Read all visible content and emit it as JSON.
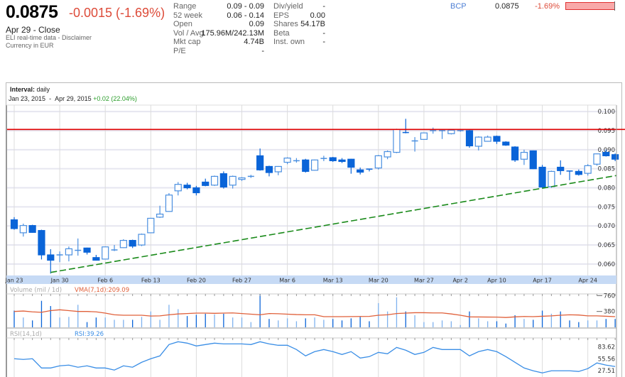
{
  "quote": {
    "price": "0.0875",
    "change": "-0.0015 (-1.69%)",
    "close_label": "Apr 29 - Close",
    "source_note": "ELI real-time data - Disclaimer",
    "currency_note": "Currency in EUR",
    "change_color": "#dd4b39"
  },
  "stats_left": [
    {
      "label": "Range",
      "value": "0.09 - 0.09"
    },
    {
      "label": "52 week",
      "value": "0.06 - 0.14"
    },
    {
      "label": "Open",
      "value": "0.09"
    },
    {
      "label": "Vol / Avg.",
      "value": "175.96M/242.13M"
    },
    {
      "label": "Mkt cap",
      "value": "4.74B"
    },
    {
      "label": "P/E",
      "value": "-"
    }
  ],
  "stats_right": [
    {
      "label": "Div/yield",
      "value": "-"
    },
    {
      "label": "EPS",
      "value": "0.00"
    },
    {
      "label": "Shares",
      "value": "54.17B"
    },
    {
      "label": "Beta",
      "value": "-"
    },
    {
      "label": "Inst. own",
      "value": "-"
    }
  ],
  "compare": {
    "symbol": "BCP",
    "price": "0.0875",
    "change": "-1.69%"
  },
  "chart_header": {
    "interval_label": "Interval:",
    "interval_value": "daily",
    "start_date": "Jan 23, 2015",
    "separator": "-",
    "end_date": "Apr 29, 2015",
    "period_change": "+0.02 (22.04%)"
  },
  "chart_data": [
    {
      "type": "candlestick",
      "ylim": [
        0.057,
        0.1017
      ],
      "y_ticks": [
        "0.100",
        "0.095",
        "0.090",
        "0.085",
        "0.080",
        "0.075",
        "0.070",
        "0.065",
        "0.060"
      ],
      "x_tick_labels": [
        {
          "label": "Jan 23",
          "index": 0
        },
        {
          "label": "Jan 30",
          "index": 5
        },
        {
          "label": "Feb 6",
          "index": 10
        },
        {
          "label": "Feb 13",
          "index": 15
        },
        {
          "label": "Feb 20",
          "index": 20
        },
        {
          "label": "Feb 27",
          "index": 25
        },
        {
          "label": "Mar 6",
          "index": 30
        },
        {
          "label": "Mar 13",
          "index": 35
        },
        {
          "label": "Mar 20",
          "index": 40
        },
        {
          "label": "Mar 27",
          "index": 45
        },
        {
          "label": "Apr 2",
          "index": 49
        },
        {
          "label": "Apr 10",
          "index": 53
        },
        {
          "label": "Apr 17",
          "index": 58
        },
        {
          "label": "Apr 24",
          "index": 63
        }
      ],
      "ohlc": [
        [
          0.0716,
          0.0723,
          0.069,
          0.0693
        ],
        [
          0.0682,
          0.0706,
          0.0672,
          0.0701
        ],
        [
          0.0701,
          0.0703,
          0.0682,
          0.0683
        ],
        [
          0.0688,
          0.069,
          0.0612,
          0.0624
        ],
        [
          0.0624,
          0.0639,
          0.0575,
          0.061
        ],
        [
          0.0623,
          0.0633,
          0.0605,
          0.0624
        ],
        [
          0.0624,
          0.0646,
          0.0607,
          0.064
        ],
        [
          0.0634,
          0.0667,
          0.0622,
          0.0636
        ],
        [
          0.0642,
          0.0643,
          0.0625,
          0.0631
        ],
        [
          0.0617,
          0.0624,
          0.0609,
          0.061
        ],
        [
          0.0613,
          0.0646,
          0.0612,
          0.0645
        ],
        [
          0.0636,
          0.065,
          0.0634,
          0.0637
        ],
        [
          0.0643,
          0.0665,
          0.0642,
          0.0662
        ],
        [
          0.0662,
          0.0664,
          0.0642,
          0.0647
        ],
        [
          0.065,
          0.068,
          0.0647,
          0.0678
        ],
        [
          0.0682,
          0.0721,
          0.0681,
          0.072
        ],
        [
          0.0723,
          0.0753,
          0.0721,
          0.0731
        ],
        [
          0.0738,
          0.0786,
          0.0737,
          0.0781
        ],
        [
          0.0792,
          0.0815,
          0.078,
          0.0809
        ],
        [
          0.0807,
          0.0813,
          0.0796,
          0.08
        ],
        [
          0.08,
          0.0805,
          0.078,
          0.0787
        ],
        [
          0.0815,
          0.0824,
          0.0804,
          0.0806
        ],
        [
          0.0807,
          0.0832,
          0.0805,
          0.083
        ],
        [
          0.0837,
          0.0843,
          0.0798,
          0.0802
        ],
        [
          0.0807,
          0.0832,
          0.0798,
          0.083
        ],
        [
          0.0822,
          0.0828,
          0.0818,
          0.0826
        ],
        [
          0.0829,
          0.0834,
          0.0826,
          0.083
        ],
        [
          0.0884,
          0.0903,
          0.0845,
          0.0847
        ],
        [
          0.0856,
          0.0858,
          0.083,
          0.084
        ],
        [
          0.0842,
          0.0857,
          0.0833,
          0.0856
        ],
        [
          0.0867,
          0.088,
          0.0862,
          0.0878
        ],
        [
          0.0871,
          0.0878,
          0.0866,
          0.0871
        ],
        [
          0.0873,
          0.0876,
          0.084,
          0.0843
        ],
        [
          0.0846,
          0.0874,
          0.0845,
          0.0873
        ],
        [
          0.0877,
          0.0884,
          0.087,
          0.0877
        ],
        [
          0.0879,
          0.0881,
          0.0868,
          0.0871
        ],
        [
          0.0873,
          0.0878,
          0.0865,
          0.0869
        ],
        [
          0.0875,
          0.0876,
          0.0837,
          0.0854
        ],
        [
          0.0847,
          0.0853,
          0.0835,
          0.0841
        ],
        [
          0.0849,
          0.085,
          0.0843,
          0.0847
        ],
        [
          0.0852,
          0.0886,
          0.0848,
          0.0884
        ],
        [
          0.0881,
          0.0898,
          0.0875,
          0.0895
        ],
        [
          0.0893,
          0.0955,
          0.0891,
          0.0953
        ],
        [
          0.0945,
          0.0981,
          0.0943,
          0.0944
        ],
        [
          0.0923,
          0.0933,
          0.0895,
          0.0923
        ],
        [
          0.0927,
          0.0945,
          0.0926,
          0.0944
        ],
        [
          0.0948,
          0.0958,
          0.0942,
          0.095
        ],
        [
          0.095,
          0.0953,
          0.0928,
          0.095
        ],
        [
          0.0942,
          0.0952,
          0.094,
          0.0951
        ],
        [
          0.095,
          0.0953,
          0.0947,
          0.095
        ],
        [
          0.095,
          0.0952,
          0.0905,
          0.091
        ],
        [
          0.0909,
          0.0935,
          0.0898,
          0.0933
        ],
        [
          0.0922,
          0.0937,
          0.0921,
          0.0933
        ],
        [
          0.0935,
          0.0937,
          0.0915,
          0.0922
        ],
        [
          0.092,
          0.0922,
          0.091,
          0.0912
        ],
        [
          0.0907,
          0.0909,
          0.0868,
          0.0873
        ],
        [
          0.0875,
          0.09,
          0.086,
          0.0893
        ],
        [
          0.0897,
          0.0898,
          0.0849,
          0.085
        ],
        [
          0.0854,
          0.086,
          0.08,
          0.0802
        ],
        [
          0.0803,
          0.0845,
          0.08,
          0.0843
        ],
        [
          0.0854,
          0.0872,
          0.0834,
          0.0845
        ],
        [
          0.0844,
          0.0845,
          0.082,
          0.0843
        ],
        [
          0.0843,
          0.0848,
          0.0832,
          0.0835
        ],
        [
          0.0838,
          0.0862,
          0.0832,
          0.0858
        ],
        [
          0.0862,
          0.089,
          0.0858,
          0.0889
        ],
        [
          0.0893,
          0.09,
          0.0882,
          0.0884
        ],
        [
          0.0887,
          0.089,
          0.087,
          0.0875
        ]
      ],
      "resistance_line": {
        "value": 0.0953,
        "color": "#e00000"
      },
      "trend_line": {
        "start": {
          "index": 4,
          "value": 0.0578
        },
        "end": {
          "index": 66.1,
          "value": 0.0832
        },
        "color": "#1a8a1a",
        "style": "dashed"
      },
      "up_color": "#ffffff",
      "down_color": "#0a64d8",
      "grid": true
    },
    {
      "type": "bar",
      "title": "Volume (mil / 1d)",
      "indicator_label": "VMA(7,1d):209.09",
      "ylim": [
        0,
        800
      ],
      "y_ticks": [
        "760",
        "380"
      ],
      "y_tick_values": [
        760,
        380
      ],
      "values": [
        400,
        235,
        165,
        635,
        510,
        235,
        250,
        540,
        125,
        235,
        235,
        180,
        180,
        180,
        250,
        380,
        180,
        540,
        435,
        270,
        300,
        325,
        310,
        325,
        235,
        235,
        125,
        800,
        200,
        165,
        215,
        145,
        215,
        235,
        180,
        200,
        165,
        215,
        250,
        145,
        580,
        380,
        720,
        380,
        290,
        125,
        125,
        165,
        145,
        55,
        380,
        215,
        145,
        145,
        90,
        290,
        200,
        180,
        400,
        325,
        380,
        165,
        125,
        165,
        165,
        200,
        200
      ],
      "vma": [
        380,
        390,
        370,
        360,
        400,
        420,
        400,
        380,
        380,
        370,
        340,
        300,
        290,
        290,
        290,
        270,
        275,
        300,
        320,
        330,
        340,
        340,
        335,
        340,
        345,
        330,
        315,
        300,
        330,
        325,
        315,
        305,
        300,
        300,
        255,
        255,
        255,
        258,
        260,
        262,
        290,
        300,
        330,
        340,
        350,
        350,
        345,
        345,
        320,
        290,
        250,
        248,
        246,
        245,
        235,
        250,
        260,
        255,
        265,
        275,
        290,
        300,
        295,
        275,
        275,
        265,
        255
      ],
      "bar_color": "#0a64d8",
      "vma_color": "#e0603a"
    },
    {
      "type": "line",
      "title": "RSI(14,1d)",
      "indicator_label": "RSI:39.26",
      "y_ticks": [
        "83.62",
        "55.56",
        "27.51"
      ],
      "y_tick_values": [
        83.62,
        55.56,
        27.51
      ],
      "ylim": [
        13,
        104
      ],
      "values": [
        55.6,
        53.9,
        55.6,
        34,
        34,
        39,
        40.7,
        35.8,
        39,
        34,
        34,
        29.2,
        39,
        35.8,
        47.3,
        55.6,
        62.2,
        88.6,
        95.2,
        91.9,
        85.3,
        88.6,
        91.9,
        90.2,
        90.2,
        90.2,
        88.6,
        95.2,
        90.2,
        86.9,
        86.9,
        77,
        62.2,
        72.1,
        77,
        72.1,
        65.5,
        72.1,
        57.2,
        60.5,
        70.4,
        67.1,
        81.9,
        75.4,
        65.5,
        70.4,
        81.9,
        77,
        77,
        77,
        62.2,
        72.1,
        77,
        72.1,
        60.5,
        47.3,
        34,
        27.5,
        22.6,
        27.5,
        27.5,
        27.5,
        25.9,
        32.5,
        45.7,
        40.7,
        37.4
      ],
      "line_color": "#3a8ee6"
    }
  ]
}
